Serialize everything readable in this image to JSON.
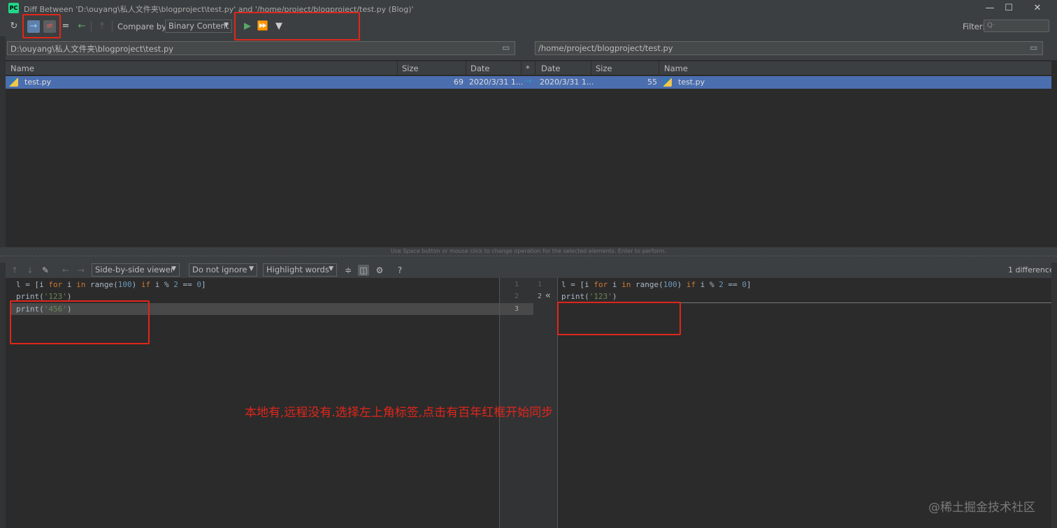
{
  "window": {
    "app_icon_text": "PC",
    "title": "Diff Between 'D:\\ouyang\\私人文件夹\\blogproject\\test.py' and '/home/project/blogproject/test.py (Blog)'",
    "minimize_glyph": "—",
    "maximize_glyph": "☐",
    "close_glyph": "✕"
  },
  "toolbar": {
    "refresh_icon": "↻",
    "sync_right_icon": "→",
    "not_equal_icon": "≠",
    "equal_icon": "=",
    "sync_left_icon": "←",
    "merge_icon": "⤒",
    "compare_by_label": "Compare by:",
    "compare_by_value": "Binary Content",
    "sync_selected_icon": "▶",
    "sync_all_icon": "⏩",
    "filter_icon": "▼",
    "filter_label": "Filter:",
    "filter_placeholder": "Q·"
  },
  "paths": {
    "left": "D:\\ouyang\\私人文件夹\\blogproject\\test.py",
    "right": "/home/project/blogproject/test.py"
  },
  "table": {
    "headers": {
      "name_left": "Name",
      "size_left": "Size",
      "date_left": "Date",
      "op": "*",
      "date_right": "Date",
      "size_right": "Size",
      "name_right": "Name"
    },
    "rows": [
      {
        "name_left": "test.py",
        "size_left": "69",
        "date_left": "2020/3/31 1...",
        "op": "→",
        "date_right": "2020/3/31 1...",
        "size_right": "55",
        "name_right": "test.py"
      }
    ],
    "hint": "Use Space button or mouse click to change operation for the selected elements. Enter to perform."
  },
  "diff_toolbar": {
    "viewer": "Side-by-side viewer",
    "ignore": "Do not ignore",
    "highlight": "Highlight words",
    "help": "?",
    "count": "1 difference"
  },
  "left_code": {
    "line1": {
      "a": "l = [i ",
      "kw1": "for",
      "b": " i ",
      "kw2": "in",
      "c": " range(",
      "n1": "100",
      "d": ") ",
      "kw3": "if",
      "e": " i % ",
      "n2": "2",
      "f": " == ",
      "n3": "0",
      "g": "]"
    },
    "line2": {
      "a": "print(",
      "s": "'123'",
      "b": ")"
    },
    "line3": {
      "a": "print(",
      "s": "'456'",
      "b": ")"
    }
  },
  "right_code": {
    "line1": {
      "a": "l = [i ",
      "kw1": "for",
      "b": " i ",
      "kw2": "in",
      "c": " range(",
      "n1": "100",
      "d": ") ",
      "kw3": "if",
      "e": " i % ",
      "n2": "2",
      "f": " == ",
      "n3": "0",
      "g": "]"
    },
    "line2": {
      "a": "print(",
      "s": "'123'",
      "b": ")"
    }
  },
  "gutter": {
    "left_numbers": [
      "1",
      "2",
      "3"
    ],
    "right_numbers": [
      "1",
      "2"
    ],
    "apply_arrow": "«"
  },
  "annotation": "本地有,远程没有.选择左上角标签,点击有百年红框开始同步",
  "watermark": "@稀土掘金技术社区",
  "colors": {
    "annotation_red": "#e0261b",
    "selection_blue": "#4b6eaf",
    "background": "#2b2b2b"
  }
}
